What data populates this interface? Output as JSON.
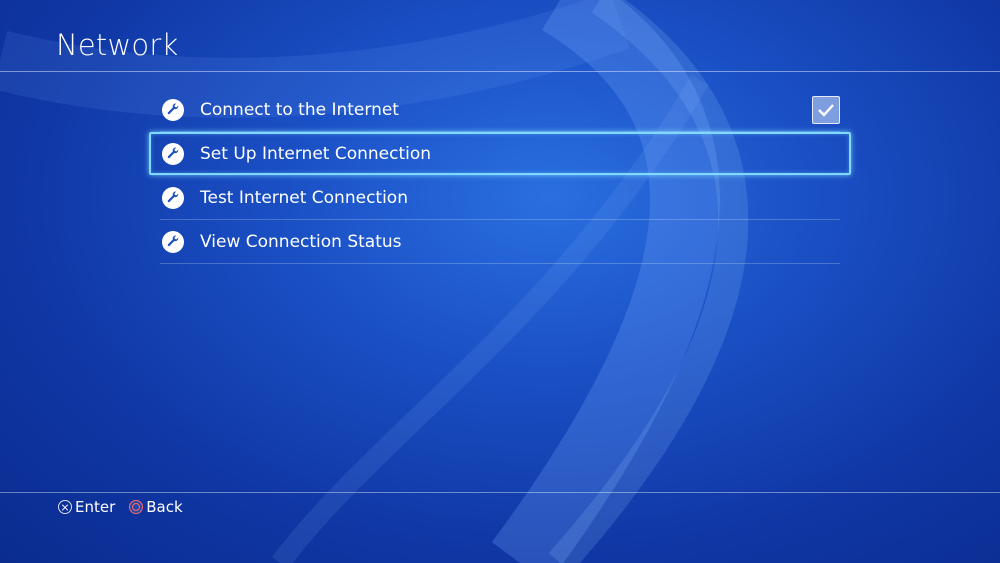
{
  "page": {
    "title": "Network"
  },
  "menu": {
    "items": [
      {
        "label": "Connect to the Internet",
        "icon": "wrench-icon",
        "checked": true,
        "selected": false
      },
      {
        "label": "Set Up Internet Connection",
        "icon": "wrench-icon",
        "selected": true
      },
      {
        "label": "Test Internet Connection",
        "icon": "wrench-icon",
        "selected": false
      },
      {
        "label": "View Connection Status",
        "icon": "wrench-icon",
        "selected": false
      }
    ]
  },
  "footer": {
    "enter_label": "Enter",
    "enter_icon": "cross-button-icon",
    "back_label": "Back",
    "back_icon": "circle-button-icon"
  },
  "colors": {
    "background": "#1a4fc4",
    "focus_outline": "#7fd9ff",
    "circle_button": "#ff6a6a"
  }
}
